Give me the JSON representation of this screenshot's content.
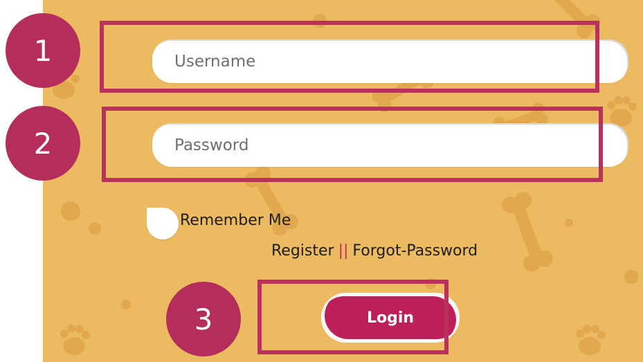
{
  "form": {
    "username_placeholder": "Username",
    "password_placeholder": "Password",
    "remember_label": "Remember Me",
    "register_link": "Register",
    "separator": "||",
    "forgot_link": "Forgot-Password",
    "login_label": "Login"
  },
  "annotations": {
    "step1": "1",
    "step2": "2",
    "step3": "3"
  },
  "colors": {
    "panel_background": "#ecba61",
    "accent": "#b9325b",
    "button": "#bd1f5a",
    "paw_decoration": "#dfa54c"
  },
  "icons": {
    "background_pattern": "paw-and-bone-pattern"
  }
}
